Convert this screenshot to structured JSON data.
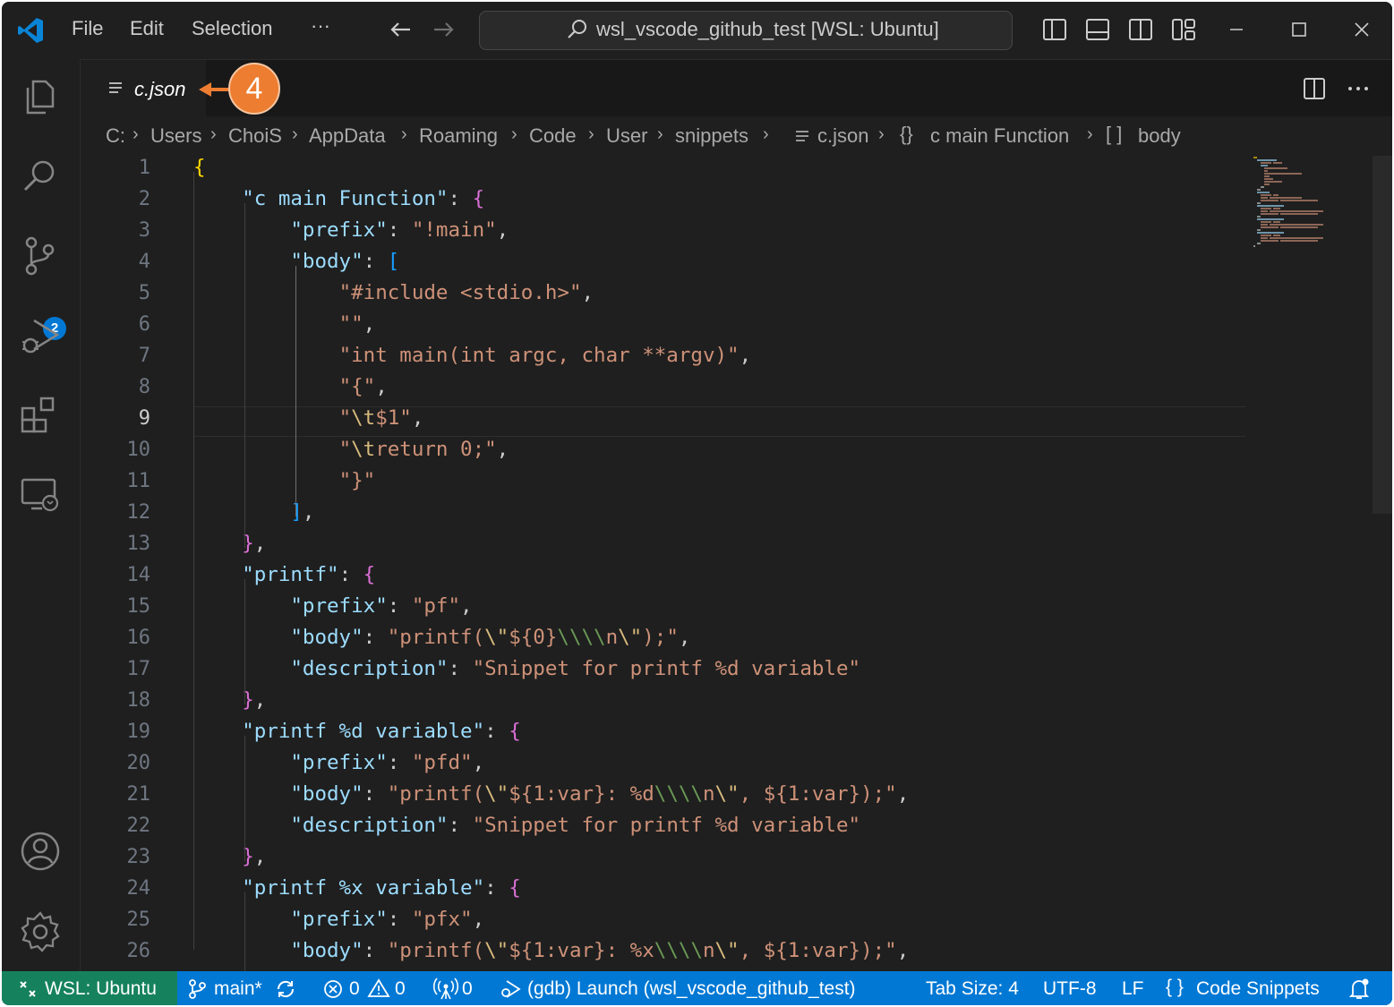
{
  "titlebar": {
    "menus": [
      "File",
      "Edit",
      "Selection",
      "···"
    ],
    "command_center": "wsl_vscode_github_test [WSL: Ubuntu]"
  },
  "activity_bar": {
    "source_control_badge": "2"
  },
  "tab": {
    "label": "c.json",
    "callout": "4"
  },
  "breadcrumb": [
    "C:",
    "Users",
    "ChoiS",
    "AppData",
    "Roaming",
    "Code",
    "User",
    "snippets",
    "c.json",
    "c main Function",
    "body"
  ],
  "editor": {
    "line_numbers": [
      "1",
      "2",
      "3",
      "4",
      "5",
      "6",
      "7",
      "8",
      "9",
      "10",
      "11",
      "12",
      "13",
      "14",
      "15",
      "16",
      "17",
      "18",
      "19",
      "20",
      "21",
      "22",
      "23",
      "24",
      "25",
      "26"
    ],
    "lines": [
      [
        [
          "b1",
          "{"
        ]
      ],
      [
        [
          "p",
          "    "
        ],
        [
          "k",
          "\"c main Function\""
        ],
        [
          "p",
          ": "
        ],
        [
          "b2",
          "{"
        ]
      ],
      [
        [
          "p",
          "        "
        ],
        [
          "k",
          "\"prefix\""
        ],
        [
          "p",
          ": "
        ],
        [
          "s",
          "\"!main\""
        ],
        [
          "p",
          ","
        ]
      ],
      [
        [
          "p",
          "        "
        ],
        [
          "k",
          "\"body\""
        ],
        [
          "p",
          ": "
        ],
        [
          "b3",
          "["
        ]
      ],
      [
        [
          "p",
          "            "
        ],
        [
          "s",
          "\"#include <stdio.h>\""
        ],
        [
          "p",
          ","
        ]
      ],
      [
        [
          "p",
          "            "
        ],
        [
          "s",
          "\"\""
        ],
        [
          "p",
          ","
        ]
      ],
      [
        [
          "p",
          "            "
        ],
        [
          "s",
          "\"int main(int argc, char **argv)\""
        ],
        [
          "p",
          ","
        ]
      ],
      [
        [
          "p",
          "            "
        ],
        [
          "s",
          "\"{\""
        ],
        [
          "p",
          ","
        ]
      ],
      [
        [
          "p",
          "            "
        ],
        [
          "s",
          "\""
        ],
        [
          "e",
          "\\t"
        ],
        [
          "s",
          "$1\""
        ],
        [
          "p",
          ","
        ]
      ],
      [
        [
          "p",
          "            "
        ],
        [
          "s",
          "\""
        ],
        [
          "e",
          "\\t"
        ],
        [
          "s",
          "return 0;\""
        ],
        [
          "p",
          ","
        ]
      ],
      [
        [
          "p",
          "            "
        ],
        [
          "s",
          "\"}\""
        ]
      ],
      [
        [
          "p",
          "        "
        ],
        [
          "b3",
          "]"
        ],
        [
          "p",
          ","
        ]
      ],
      [
        [
          "p",
          "    "
        ],
        [
          "b2",
          "}"
        ],
        [
          "p",
          ","
        ]
      ],
      [
        [
          "p",
          "    "
        ],
        [
          "k",
          "\"printf\""
        ],
        [
          "p",
          ": "
        ],
        [
          "b2",
          "{"
        ]
      ],
      [
        [
          "p",
          "        "
        ],
        [
          "k",
          "\"prefix\""
        ],
        [
          "p",
          ": "
        ],
        [
          "s",
          "\"pf\""
        ],
        [
          "p",
          ","
        ]
      ],
      [
        [
          "p",
          "        "
        ],
        [
          "k",
          "\"body\""
        ],
        [
          "p",
          ": "
        ],
        [
          "s",
          "\"printf("
        ],
        [
          "e",
          "\\\""
        ],
        [
          "s",
          "${0}"
        ],
        [
          "g",
          "\\\\\\\\"
        ],
        [
          "s",
          "n"
        ],
        [
          "e",
          "\\\""
        ],
        [
          "s",
          ");\""
        ],
        [
          "p",
          ","
        ]
      ],
      [
        [
          "p",
          "        "
        ],
        [
          "k",
          "\"description\""
        ],
        [
          "p",
          ": "
        ],
        [
          "s",
          "\"Snippet for printf %d variable\""
        ]
      ],
      [
        [
          "p",
          "    "
        ],
        [
          "b2",
          "}"
        ],
        [
          "p",
          ","
        ]
      ],
      [
        [
          "p",
          "    "
        ],
        [
          "k",
          "\"printf %d variable\""
        ],
        [
          "p",
          ": "
        ],
        [
          "b2",
          "{"
        ]
      ],
      [
        [
          "p",
          "        "
        ],
        [
          "k",
          "\"prefix\""
        ],
        [
          "p",
          ": "
        ],
        [
          "s",
          "\"pfd\""
        ],
        [
          "p",
          ","
        ]
      ],
      [
        [
          "p",
          "        "
        ],
        [
          "k",
          "\"body\""
        ],
        [
          "p",
          ": "
        ],
        [
          "s",
          "\"printf("
        ],
        [
          "e",
          "\\\""
        ],
        [
          "s",
          "${1:var}: %d"
        ],
        [
          "g",
          "\\\\\\\\"
        ],
        [
          "s",
          "n"
        ],
        [
          "e",
          "\\\""
        ],
        [
          "s",
          ", ${1:var});\""
        ],
        [
          "p",
          ","
        ]
      ],
      [
        [
          "p",
          "        "
        ],
        [
          "k",
          "\"description\""
        ],
        [
          "p",
          ": "
        ],
        [
          "s",
          "\"Snippet for printf %d variable\""
        ]
      ],
      [
        [
          "p",
          "    "
        ],
        [
          "b2",
          "}"
        ],
        [
          "p",
          ","
        ]
      ],
      [
        [
          "p",
          "    "
        ],
        [
          "k",
          "\"printf %x variable\""
        ],
        [
          "p",
          ": "
        ],
        [
          "b2",
          "{"
        ]
      ],
      [
        [
          "p",
          "        "
        ],
        [
          "k",
          "\"prefix\""
        ],
        [
          "p",
          ": "
        ],
        [
          "s",
          "\"pfx\""
        ],
        [
          "p",
          ","
        ]
      ],
      [
        [
          "p",
          "        "
        ],
        [
          "k",
          "\"body\""
        ],
        [
          "p",
          ": "
        ],
        [
          "s",
          "\"printf("
        ],
        [
          "e",
          "\\\""
        ],
        [
          "s",
          "${1:var}: %x"
        ],
        [
          "g",
          "\\\\\\\\"
        ],
        [
          "s",
          "n"
        ],
        [
          "e",
          "\\\""
        ],
        [
          "s",
          ", ${1:var});\""
        ],
        [
          "p",
          ","
        ]
      ]
    ]
  },
  "statusbar": {
    "remote": "WSL: Ubuntu",
    "branch": "main*",
    "errors": "0",
    "warnings": "0",
    "ports": "0",
    "debug": "(gdb) Launch (wsl_vscode_github_test)",
    "tab_size": "Tab Size: 4",
    "encoding": "UTF-8",
    "eol": "LF",
    "language": "Code Snippets"
  },
  "colors": {
    "accent": "#0078d4",
    "remote": "#16825d",
    "callout": "#ed7d31"
  }
}
